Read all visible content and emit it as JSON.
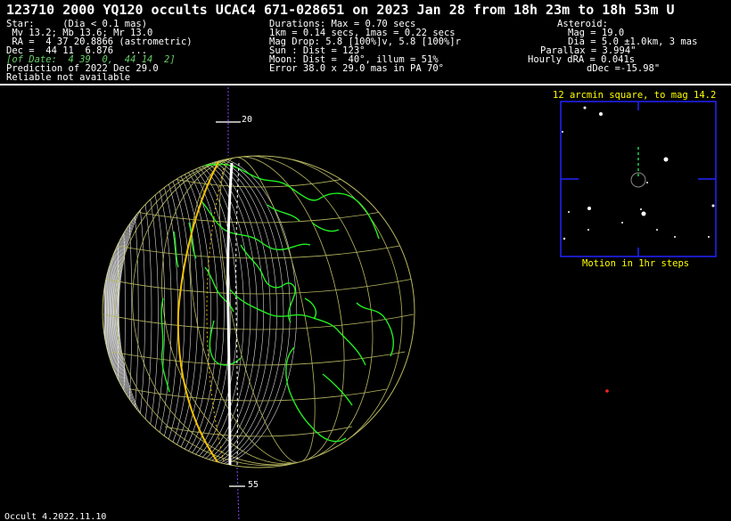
{
  "title": "123710 2000 YQ120 occults UCAC4 671-028651 on 2023 Jan 28 from 18h 23m to 18h 53m U",
  "star": {
    "line1": "Star:     (Dia < 0.1 mas)",
    "line2": " Mv 13.2; Mb 13.6; Mr 13.0",
    "line3": " RA =  4 37 20.8866 (astrometric)",
    "line4": "Dec =  44 11  6.876   ...",
    "line5": "[of Date:  4 39  0,  44 14  2]",
    "line6": "Prediction of 2022 Dec 29.0",
    "line7": "Reliable not available"
  },
  "event": {
    "line1": "Durations: Max = 0.70 secs",
    "line2": "1km = 0.14 secs, 1mas = 0.22 secs",
    "line3": "Mag Drop: 5.8 [100%]v, 5.8 [100%]r",
    "line4": "Sun : Dist = 123°",
    "line5": "Moon: Dist =  40°, illum = 51%",
    "line6": "Error 38.0 x 29.0 mas in PA 70°"
  },
  "asteroid": {
    "line1": "Asteroid:",
    "line2": "Mag = 19.0",
    "line3": "Dia = 5.0 ±1.0km, 3 mas",
    "line4": "Parallax = 3.994\"",
    "line5": "Hourly dRA = 0.041s",
    "line6": "dDec =-15.98\""
  },
  "finder": {
    "title": "12 arcmin square, to mag 14.2",
    "caption": "Motion in 1hr steps"
  },
  "path_labels": {
    "top": "20",
    "bottom": "55"
  },
  "footer": "Occult 4.2022.11.10",
  "colors": {
    "background": "#000000",
    "coastline": "#22ee22",
    "graticule": "#b8b860",
    "shadow_edge": "#ffffff",
    "center_line": "#ffffff",
    "error_limit": "#f2c200",
    "finder_frame": "#2222ff",
    "finder_text": "#ffff00"
  }
}
